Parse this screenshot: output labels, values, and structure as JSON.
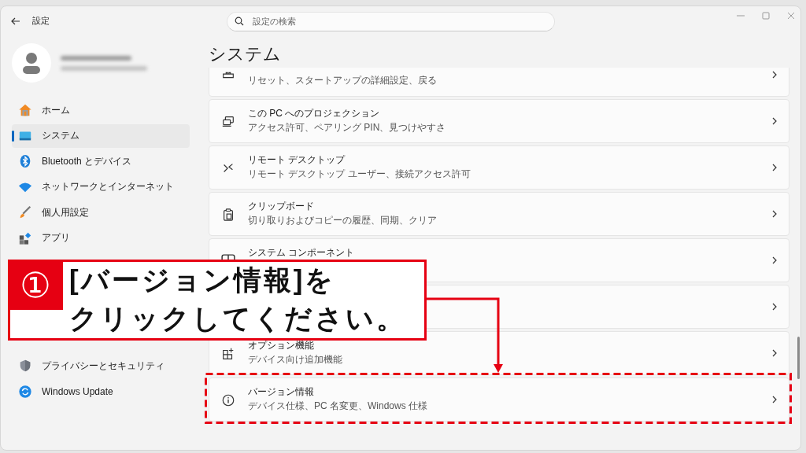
{
  "window": {
    "title": "設定",
    "search": {
      "placeholder": "設定の検索"
    }
  },
  "sidebar": {
    "items_top": [
      {
        "label": "ホーム",
        "selected": false
      },
      {
        "label": "システム",
        "selected": true
      },
      {
        "label": "Bluetooth とデバイス",
        "selected": false
      },
      {
        "label": "ネットワークとインターネット",
        "selected": false
      },
      {
        "label": "個人用設定",
        "selected": false
      },
      {
        "label": "アプリ",
        "selected": false
      }
    ],
    "items_bottom": [
      {
        "label": "プライバシーとセキュリティ",
        "selected": false
      },
      {
        "label": "Windows Update",
        "selected": false
      }
    ]
  },
  "page": {
    "title": "システム",
    "cards_above": [
      {
        "description": "リセット、スタートアップの詳細設定、戻る"
      },
      {
        "title": "この PC へのプロジェクション",
        "description": "アクセス許可、ペアリング PIN、見つけやすさ"
      },
      {
        "title": "リモート デスクトップ",
        "description": "リモート デスクトップ ユーザー、接続アクセス許可"
      },
      {
        "title": "クリップボード",
        "description": "切り取りおよびコピーの履歴、同期、クリア"
      },
      {
        "title": "システム コンポーネント"
      }
    ],
    "cards_below": [
      {
        "title": "オプション機能",
        "description": "デバイス向け追加機能"
      },
      {
        "title": "バージョン情報",
        "description": "デバイス仕様、PC 名変更、Windows 仕様"
      }
    ]
  },
  "callout": {
    "number": "①",
    "lines": [
      "[バージョン情報]を",
      "クリックしてください。"
    ]
  }
}
